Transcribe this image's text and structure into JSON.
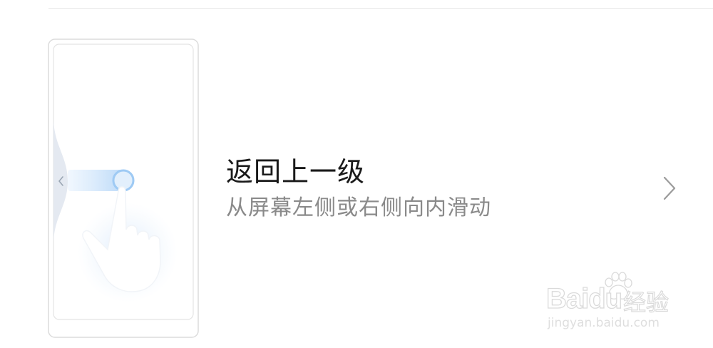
{
  "gesture": {
    "title": "返回上一级",
    "description": "从屏幕左侧或右侧向内滑动",
    "illustration_icon": "phone-swipe-back-illustration",
    "chevron_icon": "chevron-right-icon"
  },
  "watermark": {
    "logo": "Baidu",
    "product": "经验",
    "url": "jingyan.baidu.com"
  },
  "colors": {
    "title": "#1a1a1a",
    "description": "#8a8a8a",
    "divider": "#e6e6e6",
    "accent": "#5aa4ee"
  }
}
